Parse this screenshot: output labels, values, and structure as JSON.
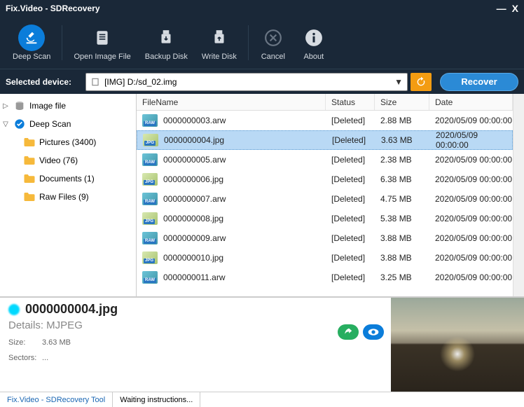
{
  "title": "Fix.Video - SDRecovery",
  "toolbar": {
    "deepscan": "Deep Scan",
    "openimage": "Open Image File",
    "backup": "Backup Disk",
    "write": "Write Disk",
    "cancel": "Cancel",
    "about": "About"
  },
  "devicebar": {
    "label": "Selected device:",
    "value": "[IMG] D:/sd_02.img",
    "recover": "Recover"
  },
  "tree": {
    "root1": "Image file",
    "root2": "Deep Scan",
    "folders": [
      {
        "label": "Pictures (3400)"
      },
      {
        "label": "Video (76)"
      },
      {
        "label": "Documents (1)"
      },
      {
        "label": "Raw Files (9)"
      }
    ]
  },
  "columns": {
    "fname": "FileName",
    "status": "Status",
    "size": "Size",
    "date": "Date"
  },
  "files": [
    {
      "name": "0000000003.arw",
      "type": "raw",
      "status": "[Deleted]",
      "size": "2.88 MB",
      "date": "2020/05/09 00:00:00"
    },
    {
      "name": "0000000004.jpg",
      "type": "jpg",
      "status": "[Deleted]",
      "size": "3.63 MB",
      "date": "2020/05/09 00:00:00",
      "selected": true
    },
    {
      "name": "0000000005.arw",
      "type": "raw",
      "status": "[Deleted]",
      "size": "2.38 MB",
      "date": "2020/05/09 00:00:00"
    },
    {
      "name": "0000000006.jpg",
      "type": "jpg",
      "status": "[Deleted]",
      "size": "6.38 MB",
      "date": "2020/05/09 00:00:00"
    },
    {
      "name": "0000000007.arw",
      "type": "raw",
      "status": "[Deleted]",
      "size": "4.75 MB",
      "date": "2020/05/09 00:00:00"
    },
    {
      "name": "0000000008.jpg",
      "type": "jpg",
      "status": "[Deleted]",
      "size": "5.38 MB",
      "date": "2020/05/09 00:00:00"
    },
    {
      "name": "0000000009.arw",
      "type": "raw",
      "status": "[Deleted]",
      "size": "3.88 MB",
      "date": "2020/05/09 00:00:00"
    },
    {
      "name": "0000000010.jpg",
      "type": "jpg",
      "status": "[Deleted]",
      "size": "3.88 MB",
      "date": "2020/05/09 00:00:00"
    },
    {
      "name": "0000000011.arw",
      "type": "raw",
      "status": "[Deleted]",
      "size": "3.25 MB",
      "date": "2020/05/09 00:00:00"
    }
  ],
  "preview": {
    "filename": "0000000004.jpg",
    "details": "Details: MJPEG",
    "size_k": "Size:",
    "size_v": "3.63 MB",
    "sectors_k": "Sectors:",
    "sectors_v": "..."
  },
  "status": {
    "link": "Fix.Video - SDRecovery Tool",
    "msg": "Waiting instructions..."
  }
}
